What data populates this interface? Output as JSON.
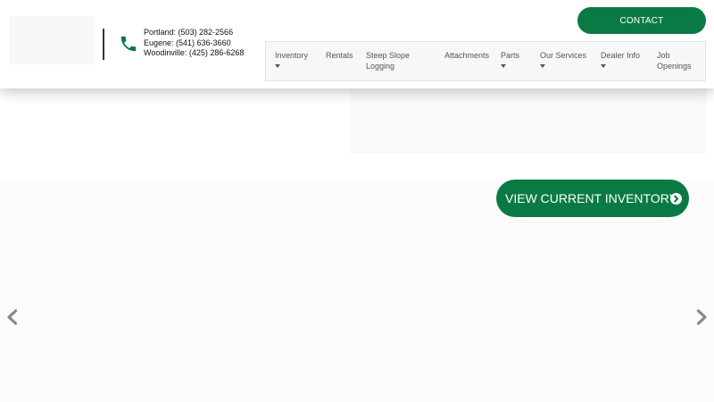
{
  "header": {
    "phones": [
      "Portland: (503) 282-2566",
      "Eugene: (541) 636-3660",
      "Woodinville: (425) 286-6268"
    ],
    "contact_label": "CONTACT"
  },
  "nav": {
    "items": [
      {
        "label": "Inventory",
        "dropdown": true
      },
      {
        "label": "Rentals",
        "dropdown": false
      },
      {
        "label": "Steep Slope Logging",
        "dropdown": false
      },
      {
        "label": "Attachments",
        "dropdown": false
      },
      {
        "label": "Parts",
        "dropdown": true
      },
      {
        "label": "Our Services",
        "dropdown": true
      },
      {
        "label": "Dealer Info",
        "dropdown": true
      },
      {
        "label": "Job Openings",
        "dropdown": false
      }
    ]
  },
  "hero": {
    "cta_label": "VIEW CURRENT INVENTORY",
    "prev_icon": "chevron-left-icon",
    "next_icon": "chevron-right-icon"
  },
  "colors": {
    "brand_green": "#0a7a45",
    "icon_gray": "#888888"
  }
}
